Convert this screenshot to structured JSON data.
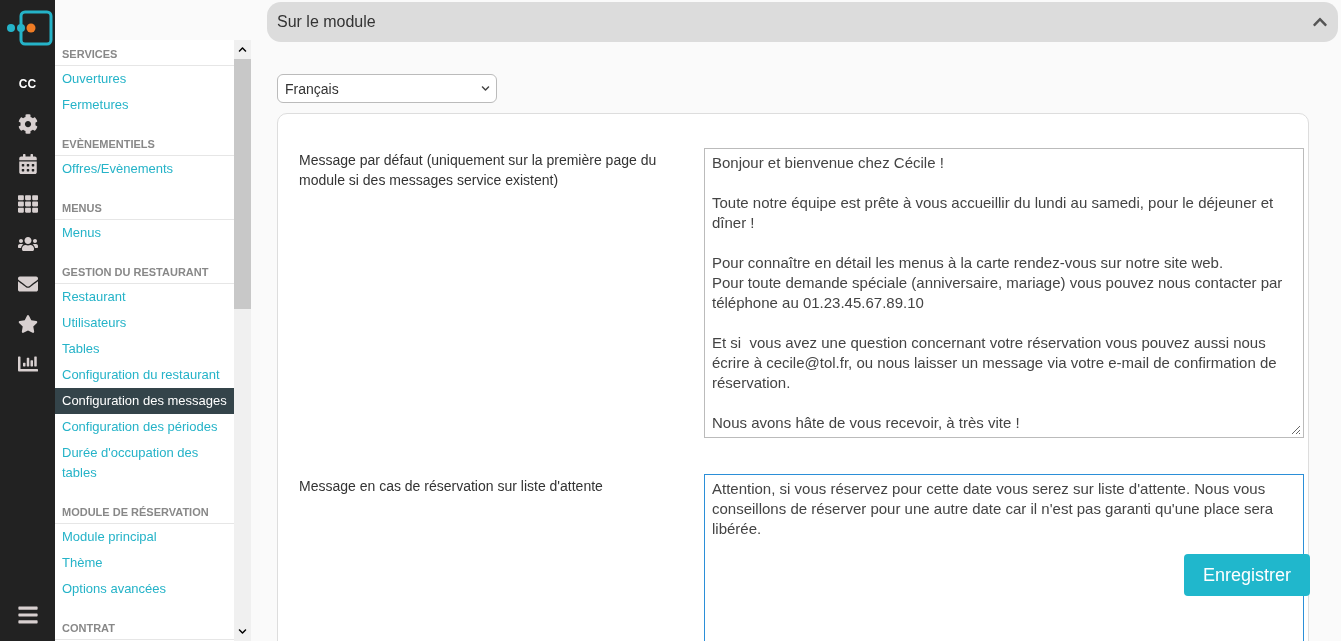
{
  "rail": {
    "initials": "CC"
  },
  "sidebar": {
    "sections": [
      {
        "heading": "SERVICES",
        "items": [
          {
            "label": "Ouvertures",
            "selected": false
          },
          {
            "label": "Fermetures",
            "selected": false
          }
        ]
      },
      {
        "heading": "EVÈNEMENTIELS",
        "items": [
          {
            "label": "Offres/Evènements",
            "selected": false
          }
        ]
      },
      {
        "heading": "MENUS",
        "items": [
          {
            "label": "Menus",
            "selected": false
          }
        ]
      },
      {
        "heading": "GESTION DU RESTAURANT",
        "items": [
          {
            "label": "Restaurant",
            "selected": false
          },
          {
            "label": "Utilisateurs",
            "selected": false
          },
          {
            "label": "Tables",
            "selected": false
          },
          {
            "label": "Configuration du restaurant",
            "selected": false
          },
          {
            "label": "Configuration des messages",
            "selected": true
          },
          {
            "label": "Configuration des périodes",
            "selected": false
          },
          {
            "label": "Durée d'occupation des tables",
            "selected": false
          }
        ]
      },
      {
        "heading": "MODULE DE RÉSERVATION",
        "items": [
          {
            "label": "Module principal",
            "selected": false
          },
          {
            "label": "Thème",
            "selected": false
          },
          {
            "label": "Options avancées",
            "selected": false
          }
        ]
      },
      {
        "heading": "CONTRAT"
      }
    ]
  },
  "panel": {
    "title": "Sur le module",
    "expanded": true,
    "language_select": {
      "value": "Français"
    },
    "fields": [
      {
        "label": "Message par défaut (uniquement sur la première page du module si des messages service existent)",
        "focused": false,
        "value": "Bonjour et bienvenue chez Cécile !\n\nToute notre équipe est prête à vous accueillir du lundi au samedi, pour le déjeuner et dîner !\n\nPour connaître en détail les menus à la carte rendez-vous sur notre site web.\nPour toute demande spéciale (anniversaire, mariage) vous pouvez nous contacter par téléphone au 01.23.45.67.89.10\n\nEt si  vous avez une question concernant votre réservation vous pouvez aussi nous écrire à cecile@tol.fr, ou nous laisser un message via votre e-mail de confirmation de réservation.\n\nNous avons hâte de vous recevoir, à très vite !"
      },
      {
        "label": "Message en cas de réservation sur liste d'attente",
        "focused": true,
        "value": "Attention, si vous réservez pour cette date vous serez sur liste d'attente. Nous vous conseillons de réserver pour une autre date car il n'est pas garanti qu'une place sera libérée."
      }
    ],
    "save_button": "Enregistrer"
  }
}
